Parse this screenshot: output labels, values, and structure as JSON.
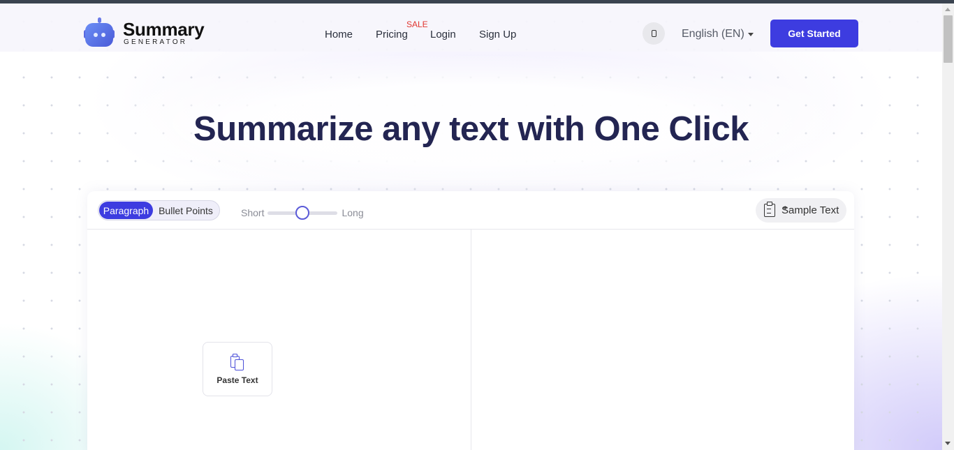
{
  "brand": {
    "name": "Summary",
    "tagline": "GENERATOR"
  },
  "nav": {
    "home": "Home",
    "pricing": "Pricing",
    "pricing_badge": "SALE",
    "login": "Login",
    "signup": "Sign Up"
  },
  "header": {
    "language": "English (EN)",
    "cta": "Get Started",
    "theme_icon": "mobile-theme-icon"
  },
  "hero": {
    "title": "Summarize any text with One Click"
  },
  "tool": {
    "modes": [
      "Paragraph",
      "Bullet Points"
    ],
    "active_mode": "Paragraph",
    "length": {
      "min_label": "Short",
      "max_label": "Long",
      "value": 0.5
    },
    "sample_text": "Sample Text",
    "paste_text": "Paste Text"
  },
  "colors": {
    "accent": "#3d3ce0",
    "heading": "#232552",
    "sale": "#e0342e"
  }
}
